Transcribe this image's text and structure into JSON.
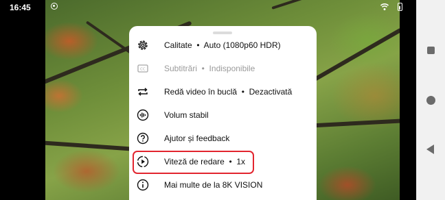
{
  "status_bar": {
    "time": "16:45"
  },
  "menu": {
    "items": [
      {
        "name": "quality",
        "icon": "gear-icon",
        "label": "Calitate  •  Auto (1080p60 HDR)",
        "disabled": false
      },
      {
        "name": "subtitles",
        "icon": "closed-captions-icon",
        "label": "Subtitrări  •  Indisponibile",
        "disabled": true
      },
      {
        "name": "loop-video",
        "icon": "loop-icon",
        "label": "Redă video în buclă  •  Dezactivată",
        "disabled": false
      },
      {
        "name": "stable-volume",
        "icon": "sound-wave-icon",
        "label": "Volum stabil",
        "disabled": false
      },
      {
        "name": "help-feedback",
        "icon": "help-circle-icon",
        "label": "Ajutor și feedback",
        "disabled": false
      },
      {
        "name": "playback-speed",
        "icon": "playback-speed-icon",
        "label": "Viteză de redare  •  1x",
        "disabled": false,
        "highlighted": true
      },
      {
        "name": "more-from-channel",
        "icon": "info-icon",
        "label": "Mai multe de la 8K VISION",
        "disabled": false
      }
    ]
  },
  "colors": {
    "highlight": "#e2242e",
    "sheet": "#ffffff",
    "nav_bar": "#f1f1f1"
  }
}
